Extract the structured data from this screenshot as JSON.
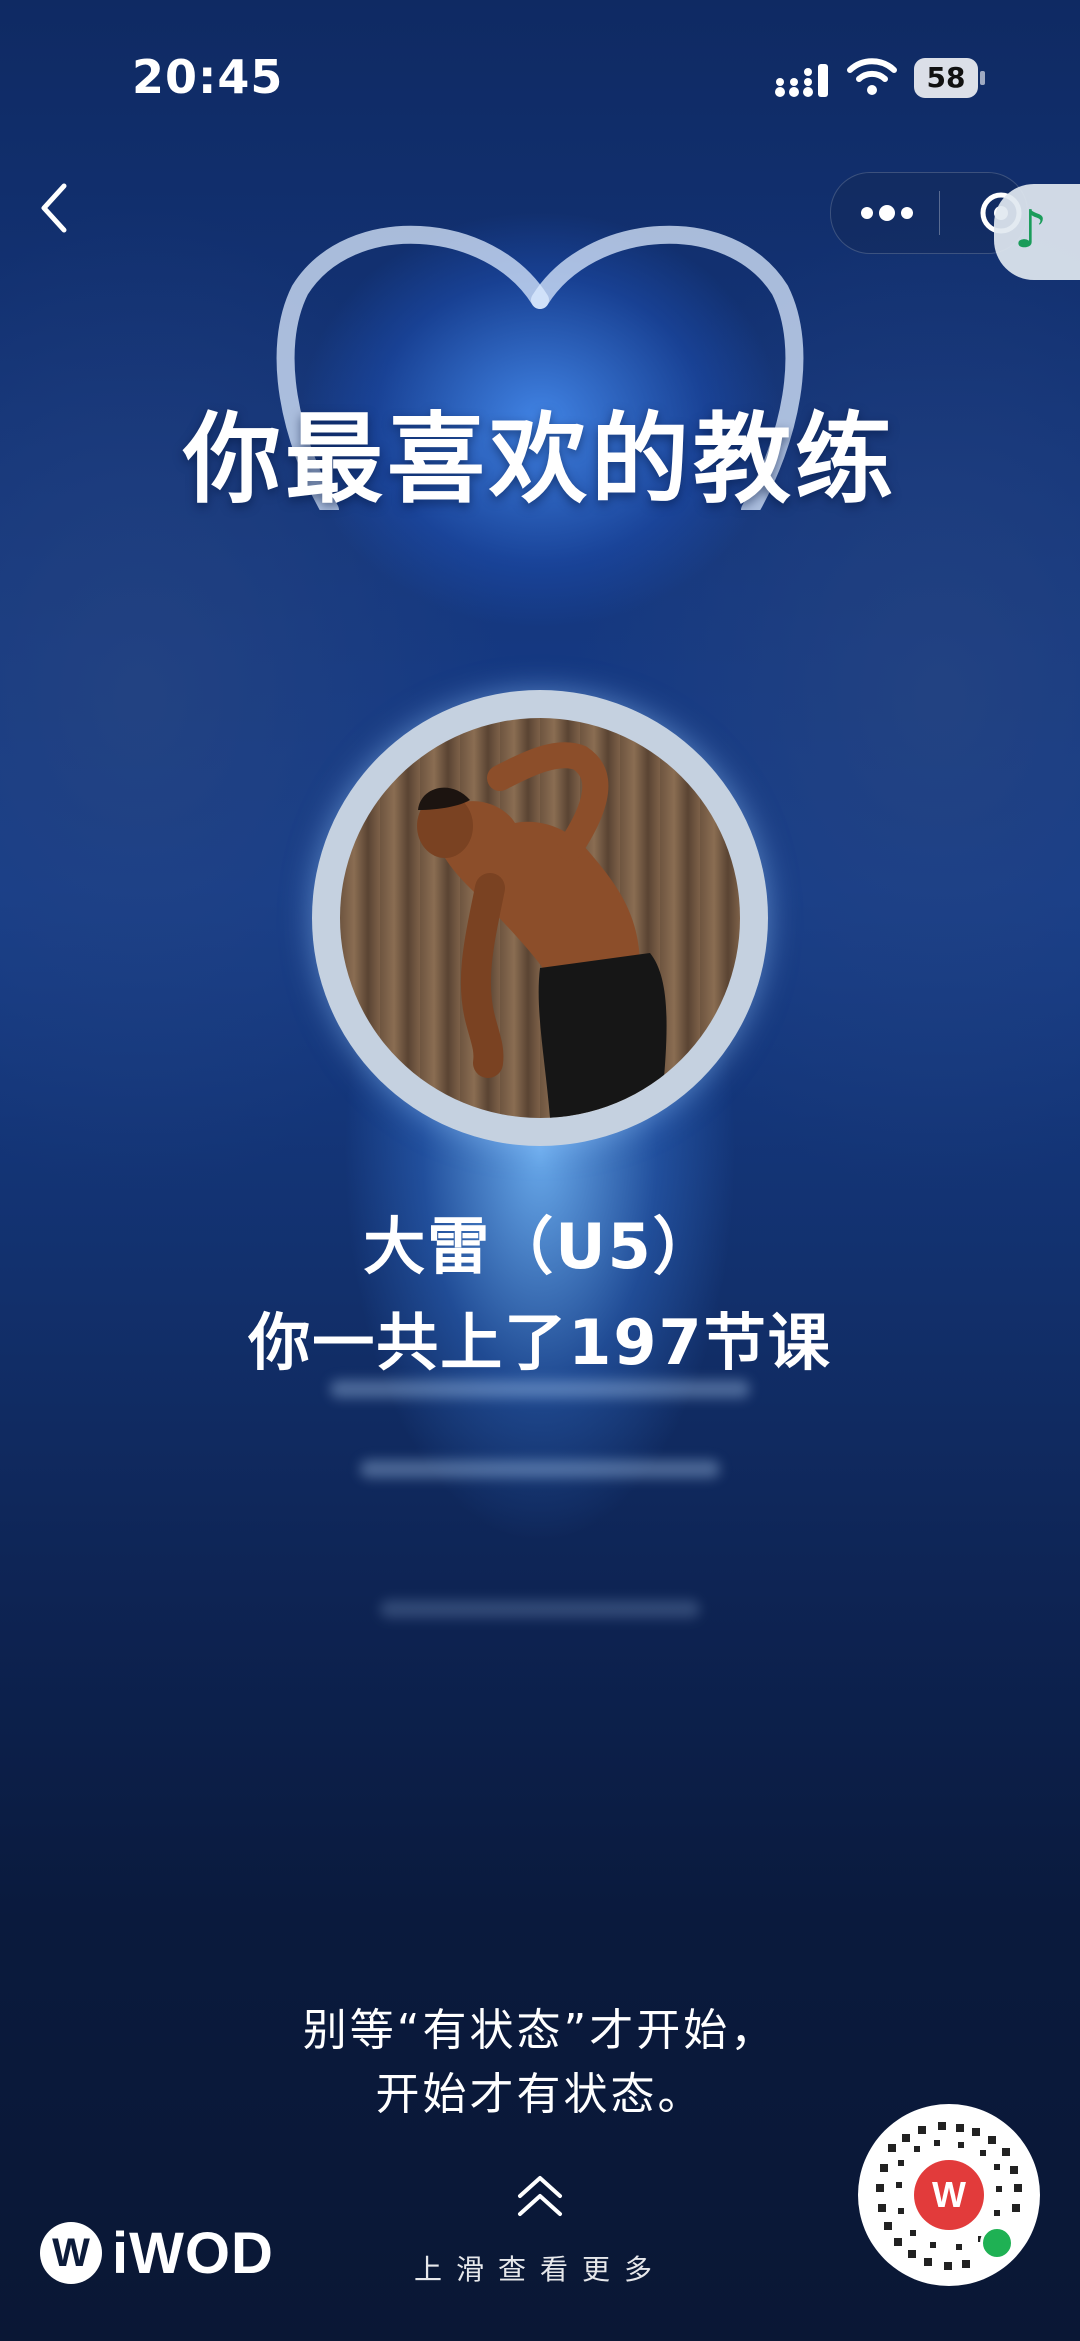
{
  "status_bar": {
    "time": "20:45",
    "battery": "58"
  },
  "title": "你最喜欢的教练",
  "coach": {
    "name": "大雷（U5）",
    "classes_text": "你一共上了197节课"
  },
  "quote": {
    "line1": "别等“有状态”才开始，",
    "line2": "开始才有状态。"
  },
  "swipe_hint": "上滑查看更多",
  "brand": {
    "mark": "W",
    "name": "iWOD"
  },
  "icons": {
    "back": "chevron-left-icon",
    "more": "more-dots-icon",
    "close": "target-close-icon",
    "music": "music-note-icon",
    "swipe": "double-chevron-up-icon",
    "qr": "mini-program-qr-icon"
  },
  "colors": {
    "background": "#0c1b3a",
    "accent_music": "#1a9c5a",
    "qr_center": "#e23b3b"
  }
}
